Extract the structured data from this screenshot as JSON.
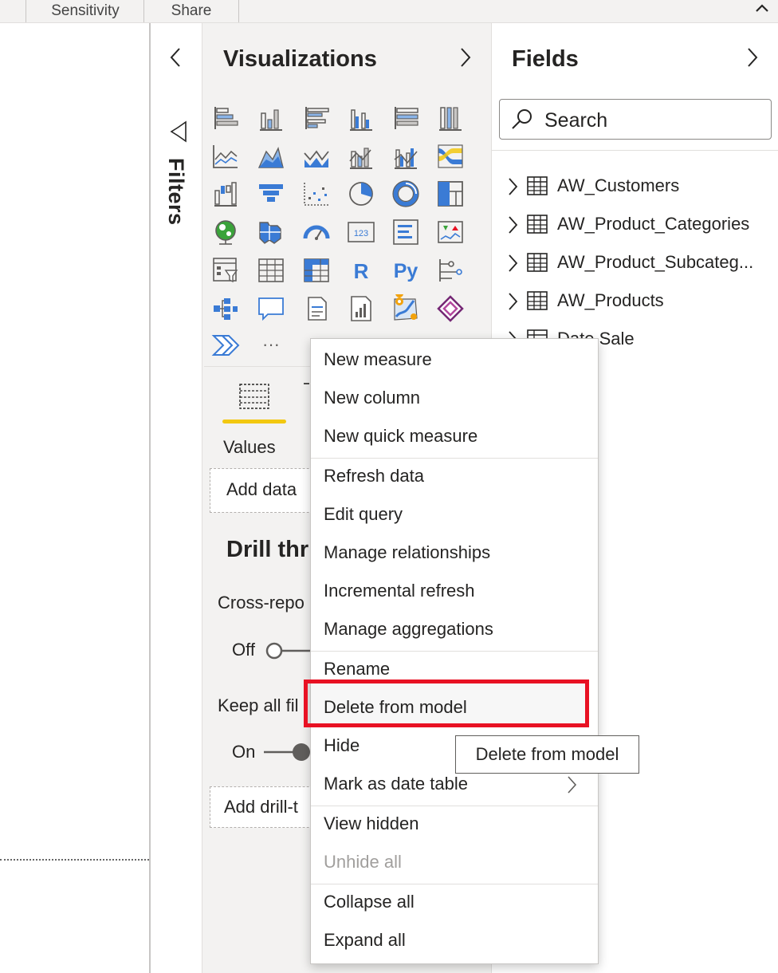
{
  "ribbon": {
    "tabs": [
      "Sensitivity",
      "Share"
    ]
  },
  "filters": {
    "label": "Filters"
  },
  "visualizations": {
    "title": "Visualizations",
    "icons": [
      "stacked-bar-chart-icon",
      "stacked-column-chart-icon",
      "clustered-bar-chart-icon",
      "clustered-column-chart-icon",
      "100-stacked-bar-chart-icon",
      "100-stacked-column-chart-icon",
      "line-chart-icon",
      "area-chart-icon",
      "stacked-area-chart-icon",
      "line-and-stacked-column-icon",
      "line-and-clustered-column-icon",
      "ribbon-chart-icon",
      "waterfall-chart-icon",
      "funnel-icon",
      "scatter-chart-icon",
      "pie-chart-icon",
      "donut-chart-icon",
      "treemap-icon",
      "map-icon",
      "filled-map-icon",
      "gauge-icon",
      "card-icon",
      "multi-row-card-icon",
      "kpi-icon",
      "slicer-icon",
      "table-icon",
      "matrix-icon",
      "r-visual-icon",
      "python-visual-icon",
      "key-influencers-icon",
      "decomposition-tree-icon",
      "qa-icon",
      "smart-narrative-icon",
      "paginated-report-icon",
      "arcgis-map-icon",
      "power-apps-icon",
      "power-automate-icon",
      "more-visuals-icon"
    ],
    "r_label": "R",
    "py_label": "Py",
    "card_label": "123",
    "more_label": "···",
    "values_label": "Values",
    "add_data": "Add data",
    "drill_title": "Drill thr",
    "cross_report": "Cross-repo",
    "off_label": "Off",
    "keep_filters": "Keep all fil",
    "on_label": "On",
    "add_drill": "Add drill-t"
  },
  "fields": {
    "title": "Fields",
    "search_placeholder": "Search",
    "tables": [
      "AW_Customers",
      "AW_Product_Categories",
      "AW_Product_Subcateg...",
      "AW_Products",
      "Date Sale"
    ]
  },
  "context_menu": {
    "groups": [
      [
        "New measure",
        "New column",
        "New quick measure"
      ],
      [
        "Refresh data",
        "Edit query",
        "Manage relationships",
        "Incremental refresh",
        "Manage aggregations"
      ],
      [
        "Rename",
        "Delete from model",
        "Hide",
        "Mark as date table"
      ],
      [
        "View hidden",
        "Unhide all"
      ],
      [
        "Collapse all",
        "Expand all"
      ]
    ],
    "disabled": [
      "Unhide all"
    ],
    "highlighted": "Delete from model",
    "highlight_color": "#e81123"
  },
  "tooltip": {
    "text": "Delete from model"
  }
}
